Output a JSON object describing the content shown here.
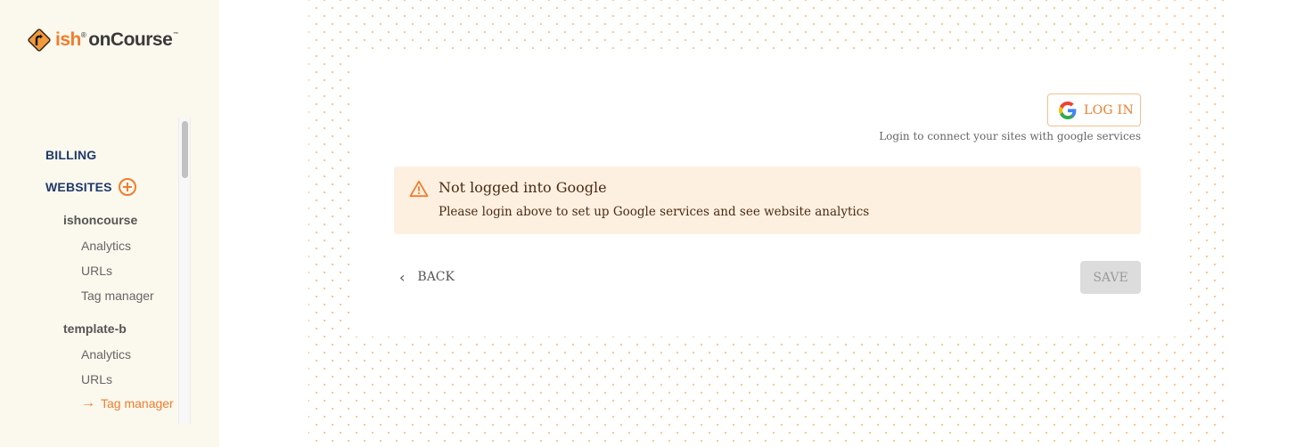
{
  "brand": {
    "logo_prefix": "ish",
    "logo_registered": "®",
    "logo_name": "onCourse",
    "logo_trademark": "™",
    "accent_color": "#f07d2c"
  },
  "sidebar": {
    "sections": [
      {
        "label": "BILLING"
      },
      {
        "label": "WEBSITES",
        "action_icon": "add-circle-icon"
      }
    ],
    "sites": [
      {
        "name": "ishoncourse",
        "links": [
          {
            "label": "Analytics"
          },
          {
            "label": "URLs"
          },
          {
            "label": "Tag manager"
          }
        ]
      },
      {
        "name": "template-b",
        "links": [
          {
            "label": "Analytics"
          },
          {
            "label": "URLs"
          },
          {
            "label": "Tag manager",
            "active": true,
            "icon": "arrow-right-icon"
          }
        ]
      }
    ]
  },
  "main": {
    "login_button_label": "LOG IN",
    "login_hint": "Login to connect your sites with google services",
    "alert": {
      "title": "Not logged into Google",
      "body": "Please login above to set up Google services and see website analytics"
    },
    "back_label": "BACK",
    "save_label": "SAVE",
    "back_chevron": "‹",
    "active_arrow": "→"
  }
}
